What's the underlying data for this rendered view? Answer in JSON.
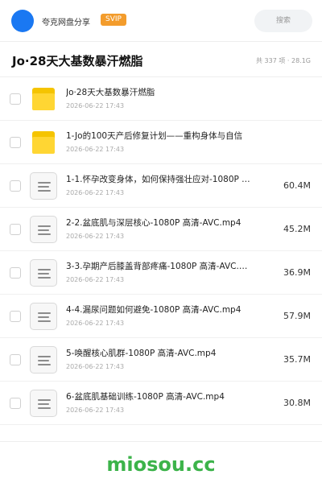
{
  "header": {
    "username": "夸克网盘分享",
    "badge": "SVIP",
    "search_placeholder": "搜索"
  },
  "folder": {
    "title": "Jo·28天大基数暴汗燃脂",
    "meta": "共 337 项 · 28.1G"
  },
  "files": [
    {
      "type": "folder",
      "name": "Jo·28天大基数暴汗燃脂",
      "date": "2026-06-22 17:43",
      "size": ""
    },
    {
      "type": "folder",
      "name": "1-Jo的100天产后修复计划——重构身体与自信",
      "date": "2026-06-22 17:43",
      "size": ""
    },
    {
      "type": "file",
      "name": "1-1.怀孕改变身体，如何保持强壮应对-1080P 高清-AVC.mp4",
      "date": "2026-06-22 17:43",
      "size": "60.4M"
    },
    {
      "type": "file",
      "name": "2-2.盆底肌与深层核心-1080P 高清-AVC.mp4",
      "date": "2026-06-22 17:43",
      "size": "45.2M"
    },
    {
      "type": "file",
      "name": "3-3.孕期产后膝盖背部疼痛-1080P 高清-AVC.mp4",
      "date": "2026-06-22 17:43",
      "size": "36.9M"
    },
    {
      "type": "file",
      "name": "4-4.漏尿问题如何避免-1080P 高清-AVC.mp4",
      "date": "2026-06-22 17:43",
      "size": "57.9M"
    },
    {
      "type": "file",
      "name": "5-唤醒核心肌群-1080P 高清-AVC.mp4",
      "date": "2026-06-22 17:43",
      "size": "35.7M"
    },
    {
      "type": "file",
      "name": "6-盆底肌基础训练-1080P 高清-AVC.mp4",
      "date": "2026-06-22 17:43",
      "size": "30.8M"
    }
  ],
  "watermark": "miosou.cc",
  "colors": {
    "accent": "#1a78f2",
    "badge": "#f39c2c",
    "folder": "#ffd633",
    "watermark": "#3cb34a"
  }
}
